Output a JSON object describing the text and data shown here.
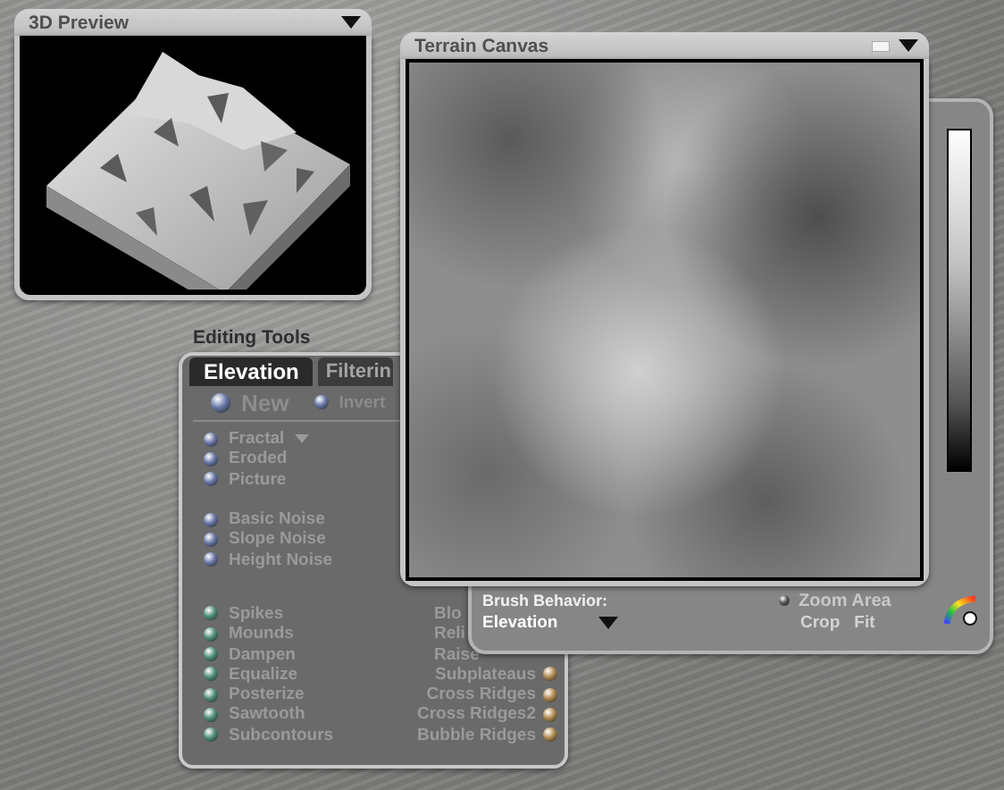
{
  "preview": {
    "title": "3D Preview"
  },
  "editing_tools": {
    "title": "Editing Tools",
    "tabs": [
      {
        "label": "Elevation",
        "selected": true
      },
      {
        "label": "Filterin",
        "selected": false
      }
    ],
    "new_button": "New",
    "invert_button": "Invert",
    "generators": [
      {
        "label": "Fractal",
        "dropdown": true
      },
      {
        "label": "Eroded",
        "dropdown": false
      },
      {
        "label": "Picture",
        "dropdown": false
      }
    ],
    "noise": [
      "Basic Noise",
      "Slope Noise",
      "Height Noise"
    ],
    "filters": [
      {
        "left": "Spikes",
        "right": "Blo",
        "right_covered": true
      },
      {
        "left": "Mounds",
        "right": "Reli",
        "right_covered": true
      },
      {
        "left": "Dampen",
        "right": "Raise",
        "right_covered": true
      },
      {
        "left": "Equalize",
        "right": "Subplateaus",
        "right_covered": false
      },
      {
        "left": "Posterize",
        "right": "Cross Ridges",
        "right_covered": false
      },
      {
        "left": "Sawtooth",
        "right": "Cross Ridges2",
        "right_covered": false
      },
      {
        "left": "Subcontours",
        "right": "Bubble Ridges",
        "right_covered": false
      }
    ]
  },
  "canvas": {
    "title": "Terrain Canvas",
    "brush_label": "Brush Behavior:",
    "brush_value": "Elevation",
    "zoom_label": "Zoom Area",
    "zoom_options": [
      "Crop",
      "Fit"
    ]
  }
}
